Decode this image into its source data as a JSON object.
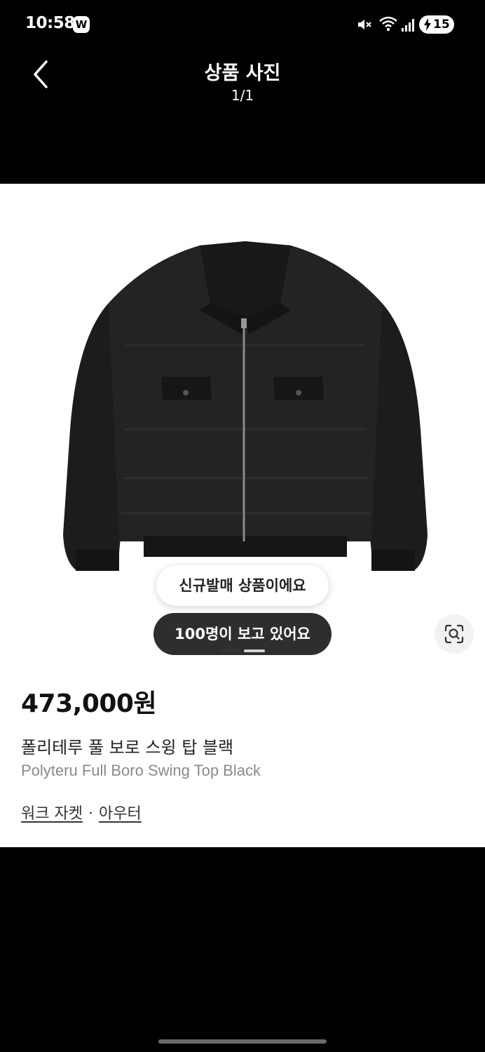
{
  "status_bar": {
    "time": "10:58",
    "app_badge": "W",
    "battery_level": "15"
  },
  "header": {
    "title": "상품 사진",
    "counter": "1/1"
  },
  "overlay": {
    "new_release_badge": "신규발매 상품이에요",
    "viewers_badge": "100명이 보고 있어요"
  },
  "product": {
    "price": "473,000원",
    "name_ko": "폴리테루 풀 보로 스윙 탑 블랙",
    "name_en": "Polyteru Full Boro Swing Top Black",
    "categories": [
      "워크 자켓",
      "아우터"
    ],
    "category_separator": "·"
  },
  "colors": {
    "background": "#000000",
    "sheet": "#ffffff",
    "viewers_badge": "#2e2e2e",
    "secondary_text": "#8a8a8a"
  },
  "icons": [
    "back-chevron-icon",
    "mute-icon",
    "wifi-icon",
    "signal-icon",
    "battery-icon",
    "lens-search-icon"
  ]
}
